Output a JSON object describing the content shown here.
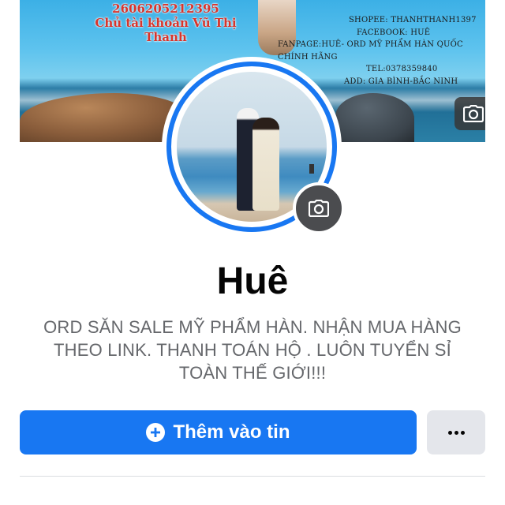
{
  "cover": {
    "left_lines": [
      "2606205212395",
      "Chủ tài khoản Vũ Thị Thanh"
    ],
    "right_lines": [
      "SHOPEE: THANHTHANH1397",
      "FACEBOOK: HUÊ",
      "FANPAGE:HUÊ- ORD MỸ PHẨM HÀN QUỐC CHÍNH HÃNG",
      "TEL:0378359840",
      "ADD: GIA BÌNH-BẮC NINH"
    ]
  },
  "profile": {
    "name": "Huê",
    "bio": "ORD SĂN SALE MỸ PHẨM HÀN. NHẬN MUA HÀNG THEO LINK. THANH TOÁN HỘ . LUÔN TUYỂN SỈ TOÀN THẾ GIỚI!!!"
  },
  "actions": {
    "add_story_label": "Thêm vào tin"
  },
  "icons": {
    "cover_camera": "camera-icon",
    "avatar_camera": "camera-icon",
    "add_story": "plus-circle-icon",
    "more": "more-horizontal-icon"
  },
  "colors": {
    "primary": "#1877f2",
    "secondary_button": "#e4e6eb",
    "muted_text": "#65676b",
    "text": "#050505"
  }
}
